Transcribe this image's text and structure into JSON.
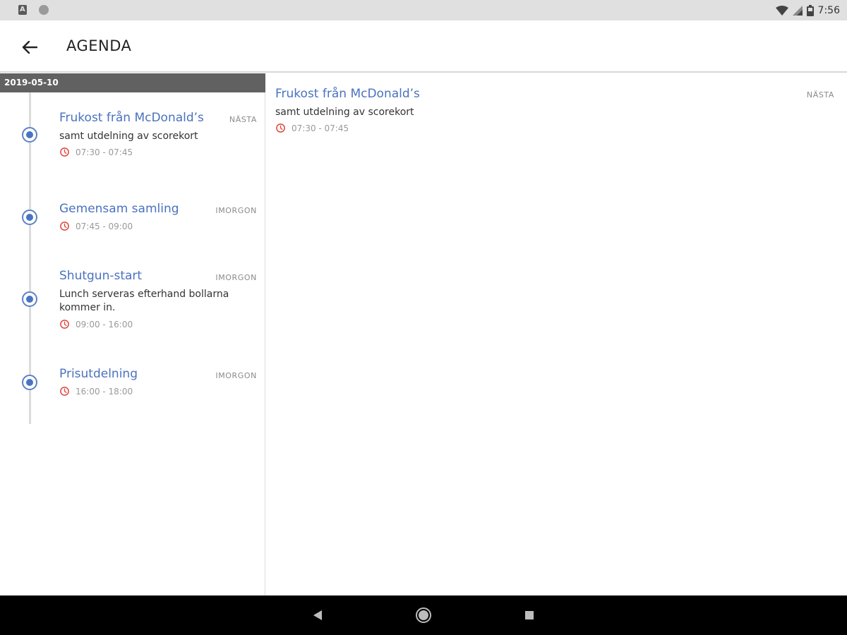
{
  "status_bar": {
    "time": "7:56",
    "left_icons": [
      "app-notification-icon",
      "circle-notification-icon"
    ],
    "right_icons": [
      "wifi-icon",
      "signal-icon",
      "battery-icon"
    ],
    "notification_letter": "A"
  },
  "app_bar": {
    "title": "AGENDA",
    "back_icon": "arrow-left-icon"
  },
  "agenda": {
    "date": "2019-05-10",
    "items": [
      {
        "title": "Frukost från McDonald’s",
        "badge": "NÄSTA",
        "description": "samt utdelning av scorekort",
        "time": "07:30 - 07:45"
      },
      {
        "title": "Gemensam samling",
        "badge": "IMORGON",
        "description": "",
        "time": "07:45 - 09:00"
      },
      {
        "title": "Shutgun-start",
        "badge": "IMORGON",
        "description": "Lunch serveras efterhand bollarna kommer in.",
        "time": "09:00 - 16:00"
      },
      {
        "title": "Prisutdelning",
        "badge": "IMORGON",
        "description": "",
        "time": "16:00 - 18:00"
      }
    ]
  },
  "detail": {
    "title": "Frukost från McDonald’s",
    "badge": "NÄSTA",
    "description": "samt utdelning av scorekort",
    "time": "07:30 - 07:45"
  },
  "colors": {
    "accent_blue": "#4a72bf",
    "clock_red": "#e0443c",
    "date_header_bg": "#616161",
    "status_bar_bg": "#e0e0e0",
    "nav_bar_bg": "#000000"
  },
  "nav_bar": {
    "icons": [
      "nav-back-icon",
      "nav-home-icon",
      "nav-recents-icon"
    ]
  }
}
